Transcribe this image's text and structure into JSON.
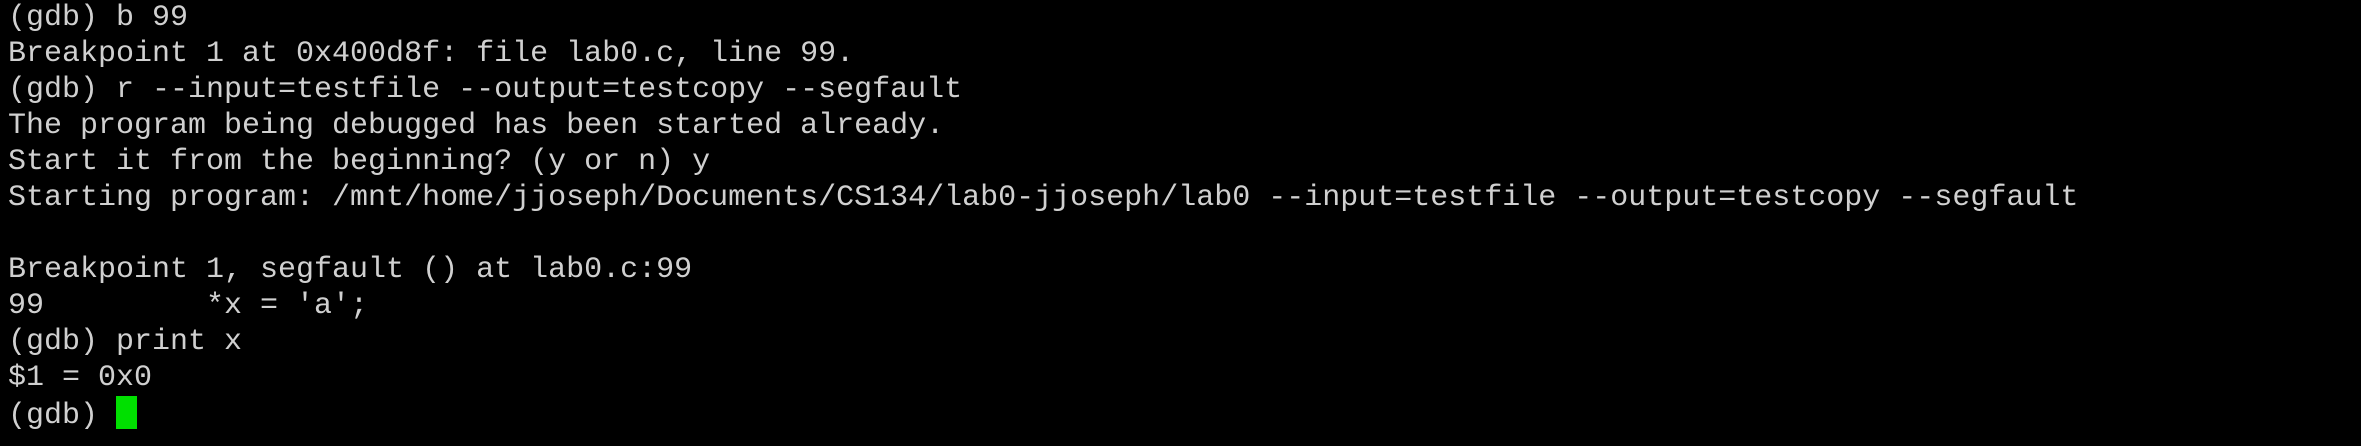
{
  "terminal": {
    "lines": [
      "(gdb) b 99",
      "Breakpoint 1 at 0x400d8f: file lab0.c, line 99.",
      "(gdb) r --input=testfile --output=testcopy --segfault",
      "The program being debugged has been started already.",
      "Start it from the beginning? (y or n) y",
      "Starting program: /mnt/home/jjoseph/Documents/CS134/lab0-jjoseph/lab0 --input=testfile --output=testcopy --segfault",
      "",
      "Breakpoint 1, segfault () at lab0.c:99",
      "99         *x = 'a';",
      "(gdb) print x",
      "$1 = 0x0"
    ],
    "prompt": "(gdb) ",
    "cursor_color": "#00e000",
    "text_color": "#d0d0d0",
    "background": "#000000"
  }
}
